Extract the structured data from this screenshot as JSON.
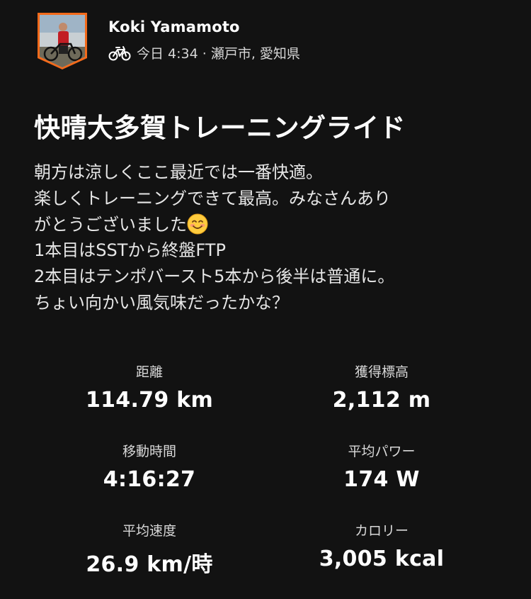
{
  "activity": {
    "athlete_name": "Koki Yamamoto",
    "sport_icon": "bicycle-icon",
    "time_location": "今日 4:34 · 瀬戸市, 愛知県",
    "title": "快晴大多賀トレーニングライド",
    "description_lines": [
      "朝方は涼しくここ最近では一番快適。",
      "楽しくトレーニングできて最高。みなさんあり",
      "がとうございました",
      "1本目はSSTから終盤FTP",
      "2本目はテンポバースト5本から後半は普通に。",
      "ちょい向かい風気味だったかな？"
    ],
    "emoji": "smiling-face-emoji"
  },
  "stats": {
    "distance": {
      "label": "距離",
      "value": "114.79 km"
    },
    "elevation": {
      "label": "獲得標高",
      "value": "2,112 m"
    },
    "moving_time": {
      "label": "移動時間",
      "value": "4:16:27"
    },
    "avg_power": {
      "label": "平均パワー",
      "value": "174 W"
    },
    "avg_speed": {
      "label": "平均速度",
      "value": "26.9 km/時"
    },
    "calories": {
      "label": "カロリー",
      "value": "3,005 kcal"
    }
  },
  "colors": {
    "background": "#121212",
    "avatar_border": "#f26a1b",
    "text": "#ffffff"
  }
}
